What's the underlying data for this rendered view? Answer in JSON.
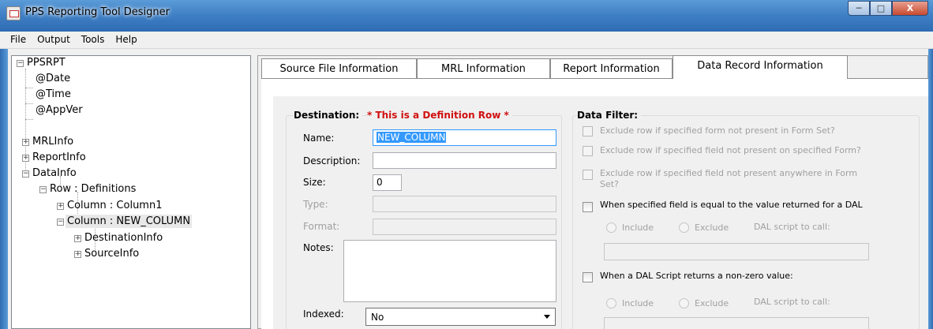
{
  "window": {
    "title": "PPS Reporting Tool Designer",
    "controls": {
      "minimize": "─",
      "maximize": "□",
      "close": "X"
    }
  },
  "menu": [
    "File",
    "Output",
    "Tools",
    "Help"
  ],
  "tree": {
    "root": "PPSRPT",
    "nodes": [
      "@Date",
      "@Time",
      "@AppVer",
      "MRLInfo",
      "ReportInfo",
      "DataInfo",
      "Row : Definitions",
      "Column : Column1",
      "Column : NEW_COLUMN",
      "DestinationInfo",
      "SourceInfo"
    ]
  },
  "tabs": [
    "Source File Information",
    "MRL Information",
    "Report Information",
    "Data Record Information"
  ],
  "destination": {
    "title": "Destination:",
    "definition_note": "* This is a Definition Row *",
    "name_label": "Name:",
    "name_value": "NEW_COLUMN",
    "description_label": "Description:",
    "size_label": "Size:",
    "size_value": "0",
    "type_label": "Type:",
    "format_label": "Format:",
    "notes_label": "Notes:",
    "indexed_label": "Indexed:",
    "indexed_value": "No"
  },
  "data_filter": {
    "title": "Data Filter:",
    "opt1": "Exclude row if specified form not present in Form Set?",
    "opt2": "Exclude row if specified field not present on specified Form?",
    "opt3_line1": "Exclude row if specified field not present anywhere in Form",
    "opt3_line2": "Set?",
    "opt4": "When specified field is equal to the value returned for a DAL",
    "include": "Include",
    "exclude": "Exclude",
    "dal_script": "DAL script to call:",
    "opt5": "When a DAL Script returns a non-zero value:"
  }
}
